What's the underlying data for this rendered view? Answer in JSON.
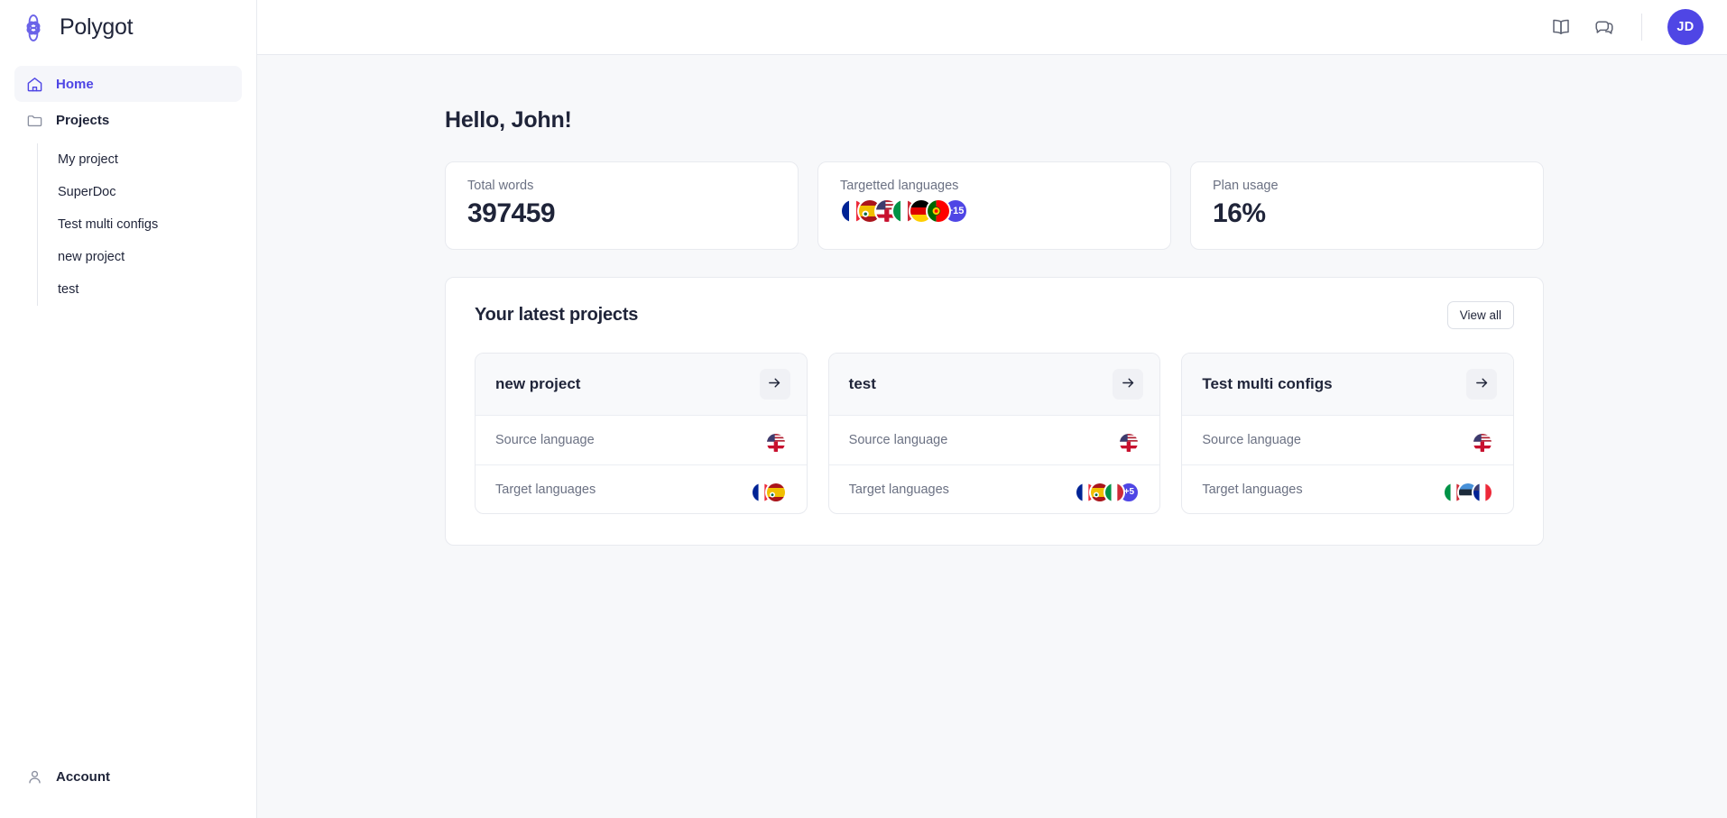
{
  "brand": {
    "name": "Polygot",
    "logo_icon": "flower-logo-icon",
    "accent": "#4f46e5"
  },
  "sidebar": {
    "home": {
      "label": "Home",
      "icon": "home-icon"
    },
    "projects": {
      "label": "Projects",
      "icon": "folder-icon"
    },
    "project_items": [
      {
        "label": "My project"
      },
      {
        "label": "SuperDoc"
      },
      {
        "label": "Test multi configs"
      },
      {
        "label": "new project"
      },
      {
        "label": "test"
      }
    ],
    "account": {
      "label": "Account",
      "icon": "user-icon"
    }
  },
  "topbar": {
    "book_icon": "book-icon",
    "chat_icon": "chat-bubble-icon",
    "avatar_initials": "JD"
  },
  "main": {
    "greeting": "Hello, John!",
    "stats": [
      {
        "label": "Total words",
        "value": "397459",
        "kind": "number"
      },
      {
        "label": "Targetted languages",
        "kind": "flags",
        "more": "+15",
        "flags": [
          "france",
          "spain-mexico",
          "usa-uk",
          "italy",
          "germany",
          "portugal-ghana"
        ]
      },
      {
        "label": "Plan usage",
        "value": "16%",
        "kind": "number"
      }
    ],
    "projects_panel": {
      "title": "Your latest projects",
      "view_all_label": "View all",
      "row_labels": {
        "source": "Source language",
        "target": "Target languages"
      },
      "cards": [
        {
          "title": "new project",
          "source_flag": "usa-uk",
          "target_flags": [
            "france",
            "spain-mexico"
          ],
          "target_more": ""
        },
        {
          "title": "test",
          "source_flag": "usa-uk",
          "target_flags": [
            "france",
            "spain-mexico",
            "italy"
          ],
          "target_more": "+5"
        },
        {
          "title": "Test multi configs",
          "source_flag": "usa-uk",
          "target_flags": [
            "italy",
            "estonia",
            "france-usa"
          ],
          "target_more": ""
        }
      ]
    }
  },
  "colors": {
    "accent": "#4f46e5",
    "text": "#1f2439",
    "muted": "#6b7183",
    "canvas": "#f7f8fa",
    "border": "#e8eaef"
  }
}
